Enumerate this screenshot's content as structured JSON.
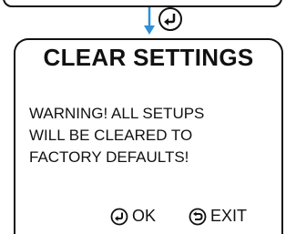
{
  "screen": {
    "title": "CLEAR SETTINGS",
    "warning_lines": [
      "WARNING! ALL SETUPS",
      "WILL BE CLEARED TO",
      "FACTORY DEFAULTS!"
    ]
  },
  "softkeys": {
    "ok_label": "OK",
    "ok_icon": "enter-icon",
    "exit_label": "EXIT",
    "exit_icon": "back-icon"
  },
  "flow": {
    "trigger_icon": "enter-icon",
    "arrow_color": "#2f8fd8"
  }
}
